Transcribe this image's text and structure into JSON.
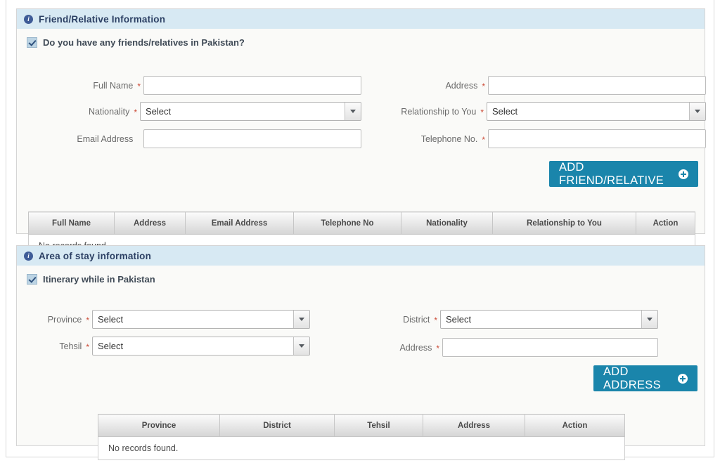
{
  "theme": {
    "panel_header_bg": "#d7e9f3",
    "panel_title_color": "#2b3f63",
    "panel_body_bg": "#fafaf8",
    "button_bg": "#1a85ab",
    "required_mark_color": "#cc4b37",
    "checkbox_bg": "#bcd4e4",
    "checkbox_check_color": "#30527e"
  },
  "friend_section": {
    "title": "Friend/Relative Information",
    "info_icon_glyph": "i",
    "checkbox": {
      "label": "Do you have any friends/relatives in Pakistan?",
      "checked": "true"
    },
    "fields": {
      "full_name": {
        "label": "Full Name",
        "required": "*",
        "value": "",
        "type": "text"
      },
      "address": {
        "label": "Address",
        "required": "*",
        "value": "",
        "type": "text"
      },
      "nationality": {
        "label": "Nationality",
        "required": "*",
        "value": "Select",
        "type": "select"
      },
      "relationship": {
        "label": "Relationship to You",
        "required": "*",
        "value": "Select",
        "type": "select"
      },
      "email": {
        "label": "Email Address",
        "required": "",
        "value": "",
        "type": "text"
      },
      "telephone": {
        "label": "Telephone No.",
        "required": "*",
        "value": "",
        "type": "text"
      }
    },
    "add_button": {
      "label": "ADD FRIEND/RELATIVE",
      "icon": "plus-circle-icon"
    },
    "table": {
      "columns": [
        "Full Name",
        "Address",
        "Email Address",
        "Telephone No",
        "Nationality",
        "Relationship to You",
        "Action"
      ],
      "empty_message": "No records found.",
      "rows": []
    }
  },
  "area_section": {
    "title": "Area of stay information",
    "info_icon_glyph": "i",
    "checkbox": {
      "label": "Itinerary while in Pakistan",
      "checked": "true"
    },
    "fields": {
      "province": {
        "label": "Province",
        "required": "*",
        "value": "Select",
        "type": "select"
      },
      "district": {
        "label": "District",
        "required": "*",
        "value": "Select",
        "type": "select"
      },
      "tehsil": {
        "label": "Tehsil",
        "required": "*",
        "value": "Select",
        "type": "select"
      },
      "address": {
        "label": "Address",
        "required": "*",
        "value": "",
        "type": "text"
      }
    },
    "add_button": {
      "label": "ADD ADDRESS",
      "icon": "plus-circle-icon"
    },
    "table": {
      "columns": [
        "Province",
        "District",
        "Tehsil",
        "Address",
        "Action"
      ],
      "empty_message": "No records found.",
      "rows": []
    }
  }
}
